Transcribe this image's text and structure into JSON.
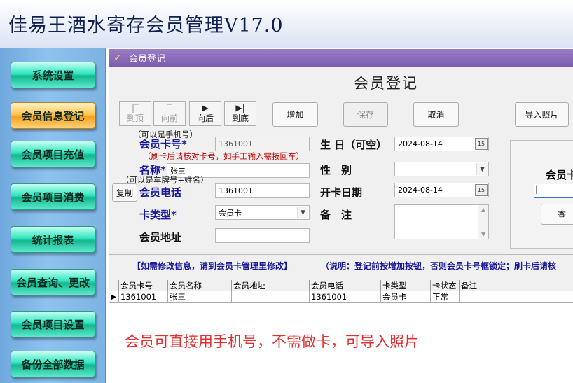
{
  "app_title": "佳易王酒水寄存会员管理V17.0",
  "sidebar": {
    "items": [
      {
        "label": "系统设置",
        "active": false
      },
      {
        "label": "会员信息登记",
        "active": true
      },
      {
        "label": "会员项目充值",
        "active": false
      },
      {
        "label": "会员项目消费",
        "active": false
      },
      {
        "label": "统计报表",
        "active": false
      },
      {
        "label": "会员查询、更改",
        "active": false
      },
      {
        "label": "会员项目设置",
        "active": false
      },
      {
        "label": "备份全部数据",
        "active": false
      }
    ]
  },
  "window": {
    "title": "会员登记",
    "heading": "会员登记"
  },
  "nav_buttons": {
    "first": {
      "icon": "|‾",
      "label": "到顶"
    },
    "prev": {
      "icon": "‾",
      "label": "向前"
    },
    "next": {
      "icon": "▶",
      "label": "向后"
    },
    "last": {
      "icon": "▶|",
      "label": "到底"
    }
  },
  "actions": {
    "add": "增加",
    "save": "保存",
    "cancel": "取消",
    "import_photo": "导入照片"
  },
  "form": {
    "hint_phone": "（可以是手机号）",
    "card_no_label": "会员卡号*",
    "card_no_value": "1361001",
    "hint_card": "（刷卡后请核对卡号，如手工输入需按回车）",
    "name_label": "名称*",
    "name_value": "张三",
    "hint_plate": "（可以是车牌号+姓名）",
    "copy_button": "复制",
    "phone_label": "会员电话",
    "phone_value": "1361001",
    "card_type_label": "卡类型*",
    "card_type_value": "会员卡",
    "address_label": "会员地址",
    "address_value": "",
    "birthday_label": "生 日（可空）",
    "birthday_value": "2024-08-14",
    "gender_label": "性　别",
    "gender_value": "",
    "open_date_label": "开卡日期",
    "open_date_value": "2024-08-14",
    "remark_label": "备　注",
    "remark_value": "",
    "right_panel_label": "会员卡",
    "right_panel_button": "查"
  },
  "notes": {
    "modify": "【如需修改信息，请到会员卡管理里修改】",
    "explain": "（说明：登记前按增加按钮，否则会员卡号框锁定；刷卡后请核"
  },
  "grid": {
    "columns": [
      "会员卡号",
      "会员名称",
      "会员地址",
      "会员电话",
      "卡类型",
      "卡状态",
      "备注"
    ],
    "rows": [
      [
        "1361001",
        "张三",
        "",
        "1361001",
        "会员卡",
        "正常",
        ""
      ]
    ]
  },
  "overlay_note": "会员可直接用手机号，不需做卡，可导入照片"
}
